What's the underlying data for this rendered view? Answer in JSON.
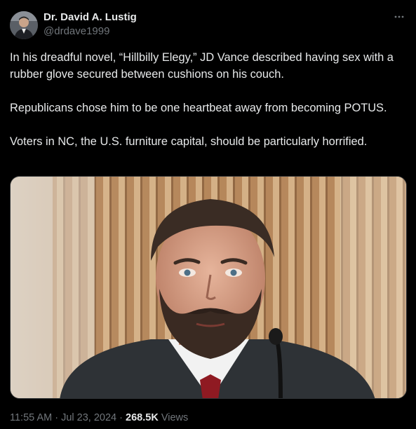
{
  "author": {
    "display_name": "Dr. David A. Lustig",
    "handle": "@drdave1999"
  },
  "tweet": {
    "text": "In his dreadful novel, “Hillbilly Elegy,” JD Vance described having sex with a rubber glove secured between cushions on his couch.\n\nRepublicans chose him to be one heartbeat away from becoming POTUS.\n\nVoters in NC, the U.S. furniture capital, should be particularly horrified."
  },
  "meta": {
    "time": "11:55 AM",
    "date": "Jul 23, 2024",
    "views_count": "268.5K",
    "views_label": "Views",
    "separator": "·"
  },
  "icons": {
    "more": "more-icon"
  },
  "colors": {
    "background": "#000000",
    "text_primary": "#e7e9ea",
    "text_secondary": "#71767b"
  }
}
